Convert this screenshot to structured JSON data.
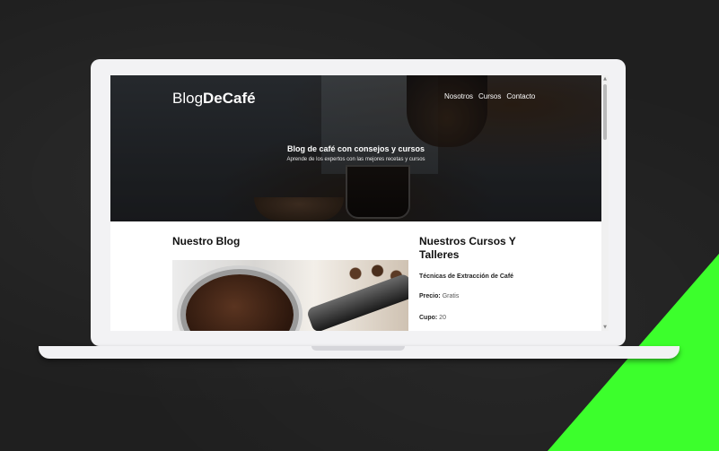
{
  "site": {
    "brand_light": "Blog",
    "brand_bold": "DeCafé",
    "nav": [
      "Nosotros",
      "Cursos",
      "Contacto"
    ]
  },
  "hero": {
    "title": "Blog de café con consejos y cursos",
    "subtitle": "Aprende de los expertos con las mejores recetas y cursos"
  },
  "blog": {
    "heading": "Nuestro Blog"
  },
  "courses": {
    "heading": "Nuestros Cursos Y Talleres",
    "course_name": "Técnicas de Extracción de Café",
    "price_label": "Precio:",
    "price_value": "Gratis",
    "cupo_label": "Cupo:",
    "cupo_value": "20"
  },
  "colors": {
    "accent": "#3cff2c",
    "background": "#1f1f1f",
    "laptop": "#f2f2f4"
  },
  "icons": {
    "scroll_up": "scroll-up-arrow-icon",
    "scroll_down": "scroll-down-arrow-icon"
  }
}
